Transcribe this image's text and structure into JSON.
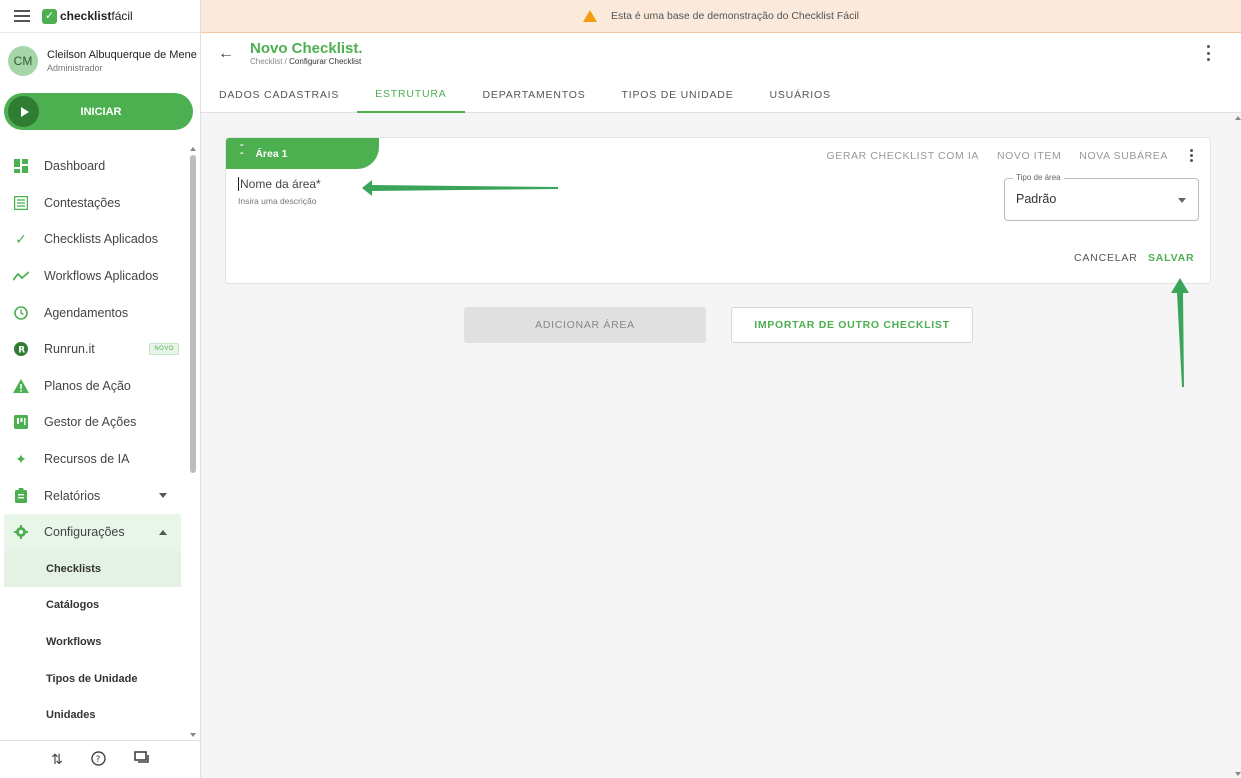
{
  "app": {
    "logo_bold": "checklist",
    "logo_light": "fácil"
  },
  "user": {
    "initials": "CM",
    "name": "Cleilson Albuquerque de Mene",
    "role": "Administrador"
  },
  "iniciar_label": "INICIAR",
  "sidebar": {
    "items": [
      {
        "label": "Dashboard",
        "icon": "dashboard-icon"
      },
      {
        "label": "Contestações",
        "icon": "list-icon"
      },
      {
        "label": "Checklists Aplicados",
        "icon": "check-icon"
      },
      {
        "label": "Workflows Aplicados",
        "icon": "trend-icon"
      },
      {
        "label": "Agendamentos",
        "icon": "clock-icon"
      },
      {
        "label": "Runrun.it",
        "icon": "runrun-icon",
        "badge": "NOVO"
      },
      {
        "label": "Planos de Ação",
        "icon": "warning-icon"
      },
      {
        "label": "Gestor de Ações",
        "icon": "board-icon"
      },
      {
        "label": "Recursos de IA",
        "icon": "sparkle-icon"
      },
      {
        "label": "Relatórios",
        "icon": "clipboard-icon"
      },
      {
        "label": "Configurações",
        "icon": "gear-icon"
      }
    ],
    "sub_items": [
      "Checklists",
      "Catálogos",
      "Workflows",
      "Tipos de Unidade",
      "Unidades"
    ]
  },
  "banner": {
    "text": "Esta é uma base de demonstração do Checklist Fácil"
  },
  "header": {
    "title": "Novo Checklist.",
    "crumb_root": "Checklist /",
    "crumb_current": "Configurar Checklist"
  },
  "tabs": [
    "DADOS CADASTRAIS",
    "ESTRUTURA",
    "DEPARTAMENTOS",
    "TIPOS DE UNIDADE",
    "USUÁRIOS"
  ],
  "active_tab": "ESTRUTURA",
  "card": {
    "area_label": "Área 1",
    "actions": [
      "GERAR CHECKLIST COM IA",
      "NOVO ITEM",
      "NOVA SUBÁREA"
    ],
    "name_placeholder": "Nome da área*",
    "desc_placeholder": "Insira uma descrição",
    "select_legend": "Tipo de área",
    "select_value": "Padrão",
    "cancel": "CANCELAR",
    "save": "SALVAR"
  },
  "buttons": {
    "add_area": "ADICIONAR ÁREA",
    "import": "IMPORTAR DE OUTRO CHECKLIST"
  },
  "colors": {
    "primary": "#4caf50",
    "banner_bg": "#fbe9db",
    "warning": "#f39c12"
  }
}
